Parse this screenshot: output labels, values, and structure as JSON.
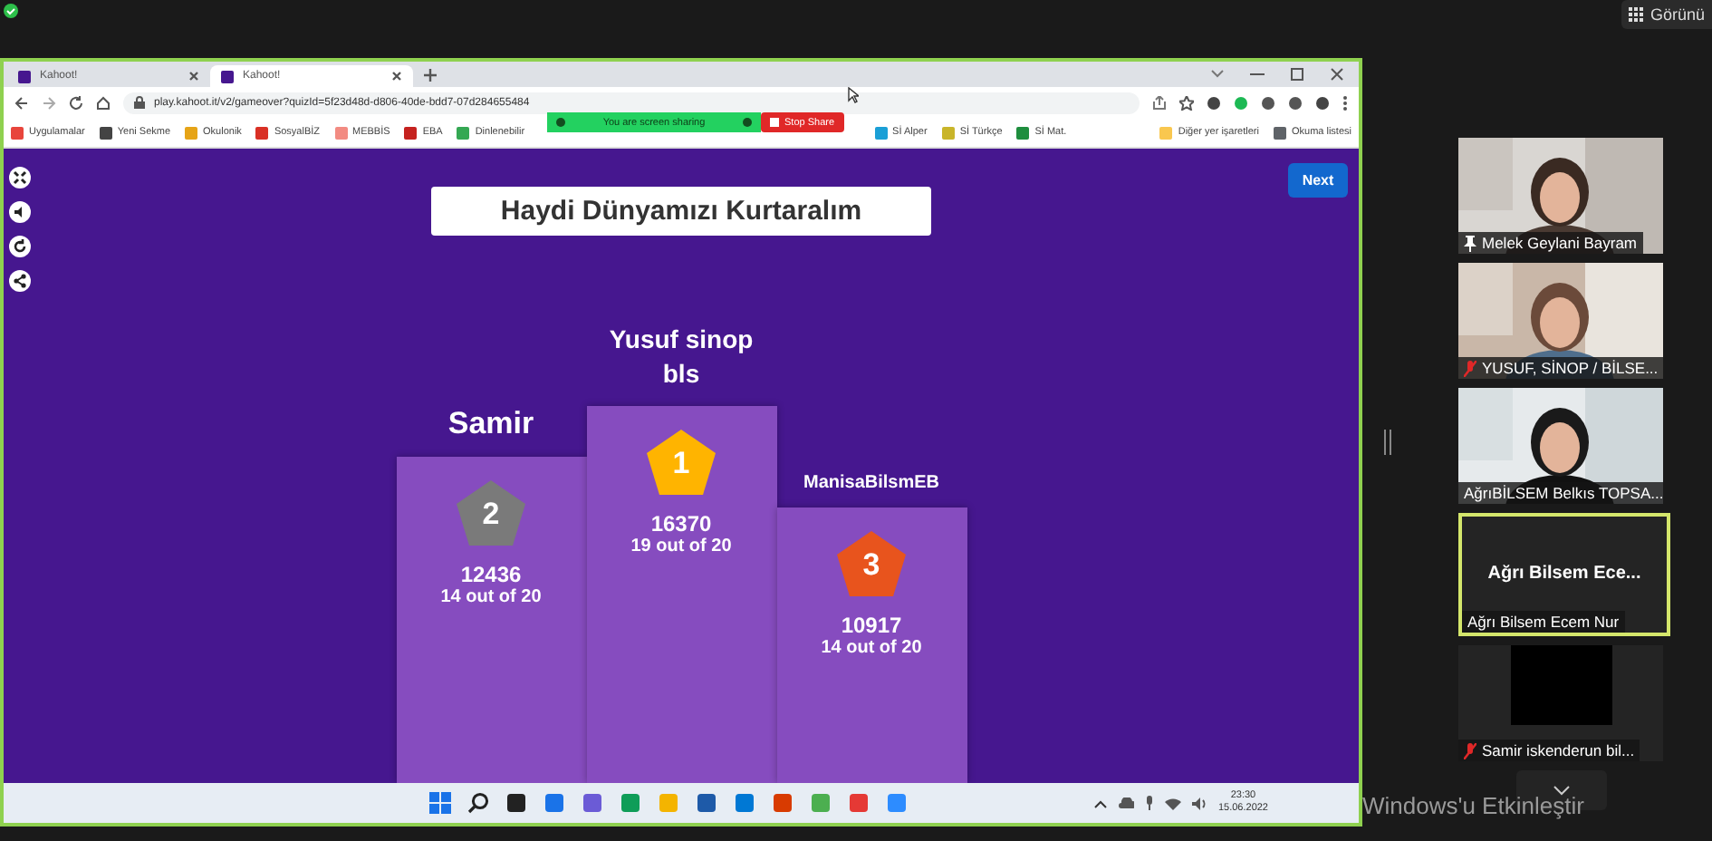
{
  "top_bar": {
    "view_button": "Görünü"
  },
  "shared_screen": {
    "browser": {
      "tabs": [
        {
          "title": "Kahoot!",
          "selected": false
        },
        {
          "title": "Kahoot!",
          "selected": true
        }
      ],
      "url": "play.kahoot.it/v2/gameover?quizId=5f23d48d-d806-40de-bdd7-07d284655484",
      "bookmarks": [
        {
          "label": "Uygulamalar",
          "color": "#e8453c"
        },
        {
          "label": "Yeni Sekme",
          "color": "#444444"
        },
        {
          "label": "Okulonik",
          "color": "#e6a417"
        },
        {
          "label": "SosyalBİZ",
          "color": "#d93025"
        },
        {
          "label": "MEBBİS",
          "color": "#f28b82"
        },
        {
          "label": "EBA",
          "color": "#c5221f"
        },
        {
          "label": "Dinlenebilir",
          "color": "#34a853"
        },
        {
          "label": "Sİ Alper",
          "color": "#1a9fd6"
        },
        {
          "label": "Sİ Türkçe",
          "color": "#c9b52a"
        },
        {
          "label": "Sİ Mat.",
          "color": "#1e8e3e"
        },
        {
          "label": "Diğer yer işaretleri",
          "color": "#f9c74f"
        },
        {
          "label": "Okuma listesi",
          "color": "#5f6368"
        }
      ],
      "sharing_bar": {
        "status": "You are screen sharing",
        "stop_button": "Stop Share"
      }
    },
    "kahoot": {
      "title": "Haydi Dünyamızı Kurtaralım",
      "next_button": "Next",
      "podium": [
        {
          "color": "#7a7a7a",
          "rank": "2",
          "name": "Samir",
          "score": "12436",
          "correct": "14 out of 20"
        },
        {
          "color": "#ffb400",
          "rank": "1",
          "name": "Yusuf sinop bls",
          "score": "16370",
          "correct": "19 out of 20"
        },
        {
          "color": "#e8541d",
          "rank": "3",
          "name": "ManisaBilsmEB",
          "score": "10917",
          "correct": "14 out of 20"
        }
      ]
    },
    "taskbar": {
      "time": "23:30",
      "date": "15.06.2022"
    }
  },
  "participants": [
    {
      "name": "Melek Geylani Bayram",
      "kind": "picture",
      "pinned": true,
      "muted": false,
      "selected": false
    },
    {
      "name": "YUSUF, SİNOP / BİLSE...",
      "kind": "picture",
      "pinned": false,
      "muted": true,
      "selected": false
    },
    {
      "name": "AğrıBİLSEM Belkıs TOPSA...",
      "kind": "picture",
      "pinned": false,
      "muted": false,
      "selected": false
    },
    {
      "name": "Ağrı Bilsem Ecem Nur",
      "display_name": "Ağrı Bilsem Ece...",
      "kind": "name",
      "pinned": false,
      "muted": false,
      "selected": true
    },
    {
      "name": "Samir  iskenderun bil...",
      "kind": "blank",
      "pinned": false,
      "muted": true,
      "selected": false
    }
  ],
  "watermark_notice": "Windows'u Etkinleştir"
}
